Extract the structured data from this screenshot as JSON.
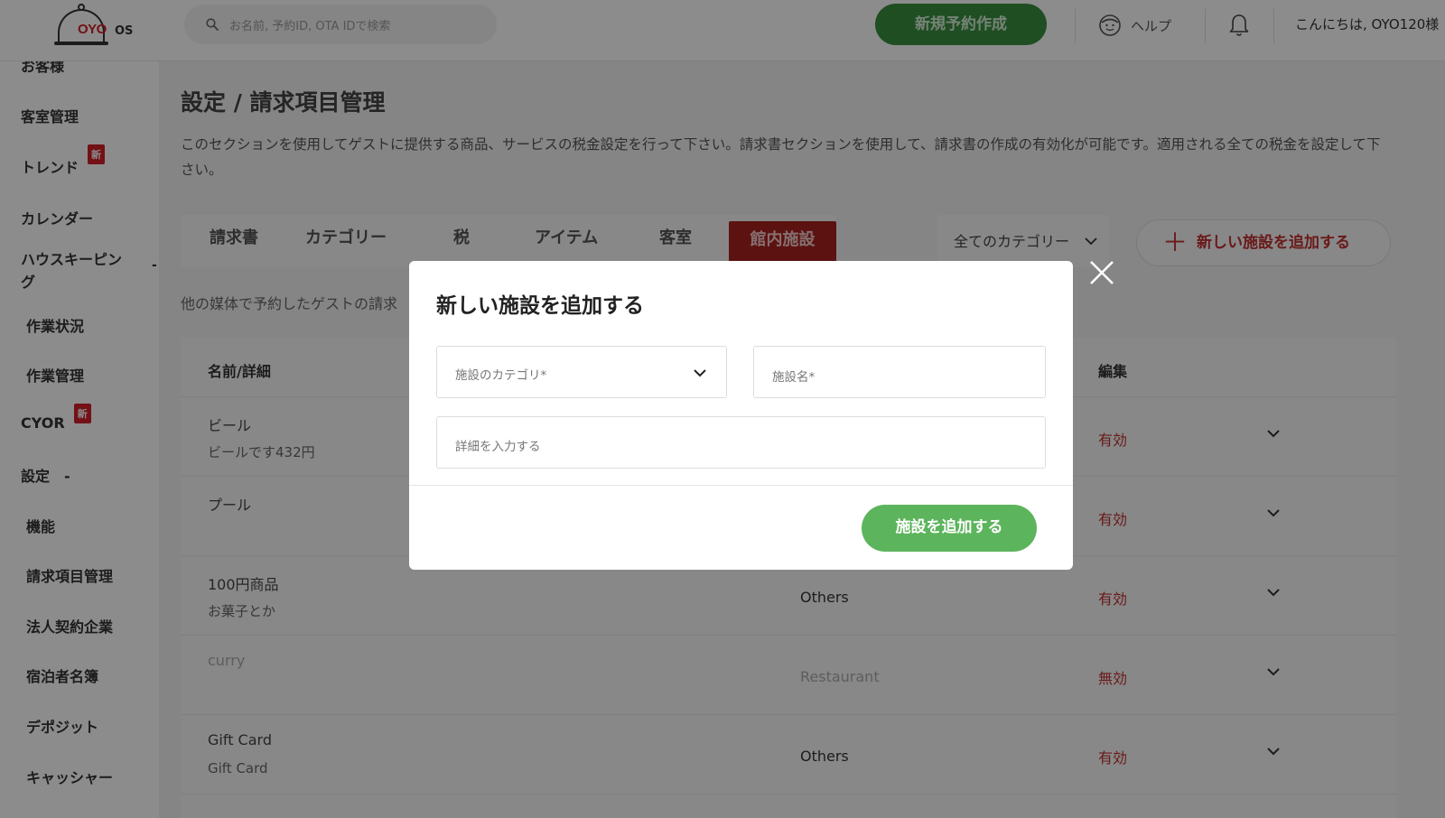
{
  "header": {
    "brand": "OYO",
    "brand_suffix": "OS",
    "search_placeholder": "お名前, 予約ID, OTA IDで検索",
    "new_booking": "新規予約作成",
    "help": "ヘルプ",
    "greeting": "こんにちは, OYO120様"
  },
  "sidebar": {
    "items": [
      {
        "label": "お客様"
      },
      {
        "label": "客室管理"
      },
      {
        "label": "トレンド",
        "badge": "新"
      },
      {
        "label": "カレンダー"
      },
      {
        "label": "ハウスキーピン",
        "label2": "グ",
        "toggle": "-"
      },
      {
        "label": "作業状況"
      },
      {
        "label": "作業管理"
      },
      {
        "label": "CYOR",
        "badge": "新"
      },
      {
        "label": "設定",
        "toggle": "-"
      },
      {
        "label": "機能"
      },
      {
        "label": "請求項目管理"
      },
      {
        "label": "法人契約企業"
      },
      {
        "label": "宿泊者名簿"
      },
      {
        "label": "デポジット"
      },
      {
        "label": "キャッシャー"
      }
    ]
  },
  "main": {
    "title": "設定 / 請求項目管理",
    "description": "このセクションを使用してゲストに提供する商品、サービスの税金設定を行って下さい。請求書セクションを使用して、請求書の作成の有効化が可能です。適用される全ての税金を設定して下さい。",
    "tabs": [
      "請求書",
      "カテゴリー",
      "税",
      "アイテム",
      "客室",
      "館内施設"
    ],
    "active_tab": "館内施設",
    "category_filter": "全てのカテゴリー",
    "add_facility_button": "新しい施設を追加する",
    "sub_description": "他の媒体で予約したゲストの請求",
    "table": {
      "headers": [
        "名前/詳細",
        "編集"
      ],
      "rows": [
        {
          "name": "ビール",
          "detail": "ビールです432円",
          "category": "",
          "status": "有効"
        },
        {
          "name": "プール",
          "detail": "",
          "category": "",
          "status": "有効"
        },
        {
          "name": "100円商品",
          "detail": "お菓子とか",
          "category": "Others",
          "status": "有効"
        },
        {
          "name": "curry",
          "detail": "",
          "category": "Restaurant",
          "status": "無効"
        },
        {
          "name": "Gift Card",
          "detail": "Gift Card",
          "category": "Others",
          "status": "有効"
        }
      ]
    }
  },
  "modal": {
    "title": "新しい施設を追加する",
    "category_placeholder": "施設のカテゴリ*",
    "name_placeholder": "施設名*",
    "detail_placeholder": "詳細を入力する",
    "submit": "施設を追加する"
  },
  "colors": {
    "primary_green": "#3a8f3f",
    "submit_green": "#5cb45c",
    "brand_red": "#d11f29",
    "active_tab": "#a8211f",
    "status_red": "#c23030"
  }
}
